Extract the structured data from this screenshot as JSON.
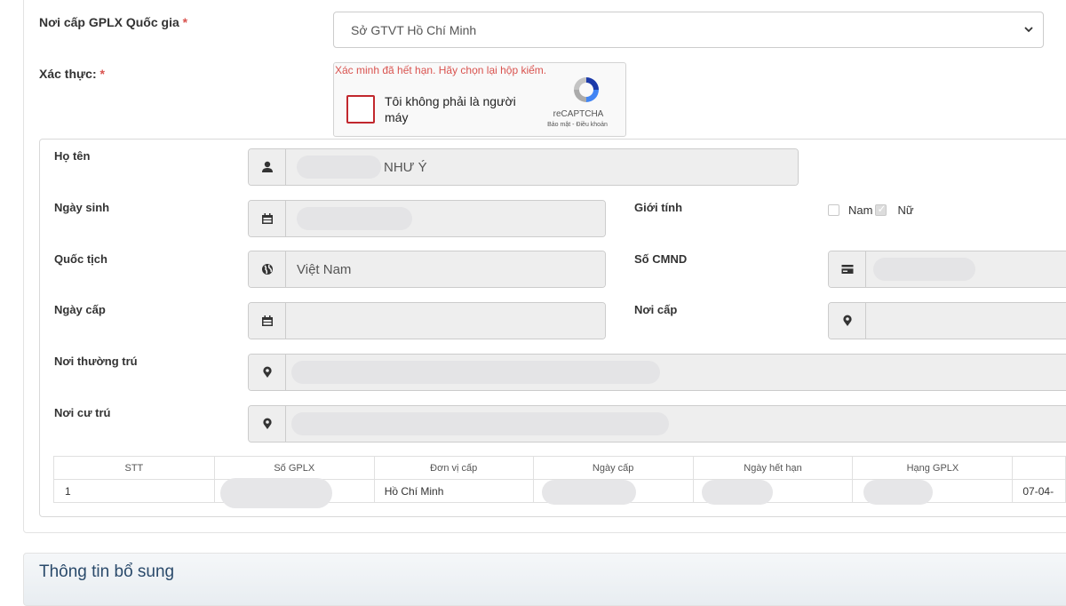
{
  "form": {
    "gplx_label": "Nơi cấp GPLX Quốc gia",
    "gplx_value": "Sở GTVT Hồ Chí Minh",
    "verify_label": "Xác thực:",
    "required_mark": "*"
  },
  "captcha": {
    "error": "Xác minh đã hết hạn. Hãy chọn lại hộp kiểm.",
    "checkbox_label": "Tôi không phải là người máy",
    "brand": "reCAPTCHA",
    "privacy": "Bảo mật",
    "separator": " - ",
    "terms": "Điều khoản"
  },
  "person": {
    "name_label": "Họ tên",
    "name_value": "NHƯ Ý",
    "dob_label": "Ngày sinh",
    "gender_label": "Giới tính",
    "gender_male": "Nam",
    "gender_female": "Nữ",
    "nationality_label": "Quốc tịch",
    "nationality_value": "Việt Nam",
    "id_label": "Số CMND",
    "issue_date_label": "Ngày cấp",
    "issue_place_label": "Nơi cấp",
    "permanent_label": "Nơi thường trú",
    "residence_label": "Nơi cư trú"
  },
  "table": {
    "headers": [
      "STT",
      "Số GPLX",
      "Đơn vị cấp",
      "Ngày cấp",
      "Ngày hết hạn",
      "Hạng GPLX"
    ],
    "row": {
      "stt": "1",
      "unit": "Hồ Chí Minh",
      "extra": "07-04-"
    }
  },
  "section": {
    "title": "Thông tin bổ sung"
  },
  "icons": {
    "user": "user-icon",
    "calendar": "calendar-icon",
    "globe": "globe-icon",
    "card": "id-card-icon",
    "marker": "map-marker-icon"
  },
  "colors": {
    "required": "#d9534f",
    "captcha_border": "#c1272d",
    "section_title": "#2a4a6b"
  }
}
